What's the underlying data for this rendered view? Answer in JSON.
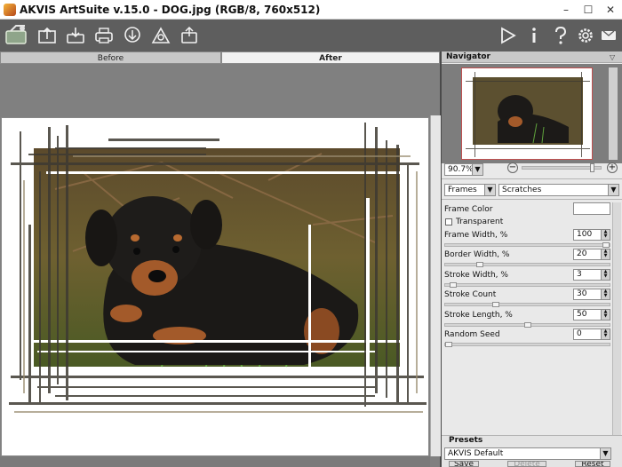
{
  "window": {
    "title": "AKVIS ArtSuite v.15.0 - DOG.jpg (RGB/8, 760x512)",
    "minimize_glyph": "–",
    "maximize_glyph": "☐",
    "close_glyph": "✕"
  },
  "toolbar": {
    "left_icons": [
      "batch-icon",
      "open-icon",
      "save-icon",
      "print-icon",
      "share-icon",
      "back-icon",
      "export-icon"
    ],
    "right_icons": [
      "run-icon",
      "info-icon",
      "help-icon",
      "settings-icon",
      "notification-icon"
    ]
  },
  "tabs": {
    "before": "Before",
    "after": "After"
  },
  "navigator": {
    "title": "Navigator",
    "zoom": "90.7%",
    "zoom_minus": "−",
    "zoom_plus": "+"
  },
  "effect": {
    "category": "Frames",
    "style": "Scratches"
  },
  "params": {
    "frame_color_label": "Frame Color",
    "frame_color": "#ffffff",
    "transparent_label": "Transparent",
    "frame_width_label": "Frame Width, %",
    "frame_width": "100",
    "frame_width_pct": 1.0,
    "border_width_label": "Border Width, %",
    "border_width": "20",
    "border_width_pct": 0.2,
    "stroke_width_label": "Stroke Width, %",
    "stroke_width": "3",
    "stroke_width_pct": 0.03,
    "stroke_count_label": "Stroke Count",
    "stroke_count": "30",
    "stroke_count_pct": 0.3,
    "stroke_length_label": "Stroke Length, %",
    "stroke_length": "50",
    "stroke_length_pct": 0.5,
    "random_seed_label": "Random Seed",
    "random_seed": "0",
    "random_seed_pct": 0.0
  },
  "presets": {
    "title": "Presets",
    "selected": "AKVIS Default",
    "save_label": "Save",
    "delete_label": "Delete",
    "reset_label": "Reset"
  }
}
